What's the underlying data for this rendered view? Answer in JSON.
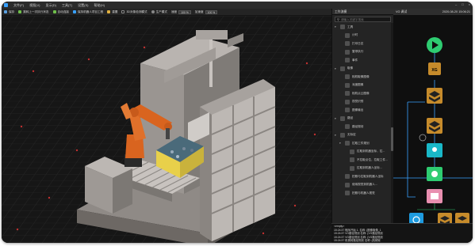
{
  "menu": {
    "items": [
      "文件(F)",
      "视图(V)",
      "显示(D)",
      "工具(T)",
      "设置(S)",
      "帮助(H)"
    ]
  },
  "toolbar": {
    "save_label": "保存",
    "step_label": "跳转上一次执行状态",
    "auto_label": "自动连接",
    "robot_project_label": "保持机器人项目工程",
    "reset_label": "重置",
    "checkbox_label": "3D对象检测模式",
    "mode_label": "生产模式",
    "speed_label": "速度",
    "speed_value": "100 %",
    "accel_label": "加速度",
    "accel_value": "100 %"
  },
  "panel": {
    "title": "工作流模",
    "search_placeholder": "请输入关键字搜索",
    "items": [
      {
        "label": "工具",
        "level": 0,
        "expanded": true
      },
      {
        "label": "计时",
        "level": 1
      },
      {
        "label": "打印日志",
        "level": 1
      },
      {
        "label": "暂停执行",
        "level": 1
      },
      {
        "label": "事件",
        "level": 1
      },
      {
        "label": "取像",
        "level": 0,
        "expanded": true
      },
      {
        "label": "相机取像图像",
        "level": 1
      },
      {
        "label": "深度图像",
        "level": 1
      },
      {
        "label": "相机点云图像",
        "level": 1
      },
      {
        "label": "视觉识别",
        "level": 1
      },
      {
        "label": "图像输出",
        "level": 1
      },
      {
        "label": "路径",
        "level": 0,
        "expanded": true
      },
      {
        "label": "路径规划",
        "level": 1
      },
      {
        "label": "无标定",
        "level": 0,
        "expanded": true
      },
      {
        "label": "拉取工件规划",
        "level": 1,
        "expanded": true
      },
      {
        "label": "拉取到机器坐标，拉...",
        "level": 2
      },
      {
        "label": "不拉取点位，拉取工件...",
        "level": 2
      },
      {
        "label": "拉取到机器人坐标...",
        "level": 2
      },
      {
        "label": "拍照与拉取到机器人坐标",
        "level": 1
      },
      {
        "label": "使用视觉到机器人...",
        "level": 1
      },
      {
        "label": "拍照与机器人视觉",
        "level": 1
      }
    ]
  },
  "flow": {
    "title": "VG 调试",
    "timestamp": "2020-08-20 15:06:21",
    "xg_label": "XG"
  },
  "log": {
    "lines": [
      "<empty>",
      "15:24:37 程序开始 1. 名称: {图像取像_1",
      "15:24:37 VG路径规划 名称: {VG路径规划",
      "15:24:37 VG路径规划 名称: {VG路径规划",
      "15:24:37 机械臂路径规划 名称: {机械臂"
    ]
  },
  "colors": {
    "accent": "#39a1ff",
    "flow_green": "#2ecc71",
    "flow_gold": "#c68b2b",
    "flow_cyan": "#19b8c8",
    "flow_pink": "#e88fb0",
    "robot_orange": "#d9641f",
    "bin_yellow": "#e8d04a"
  }
}
